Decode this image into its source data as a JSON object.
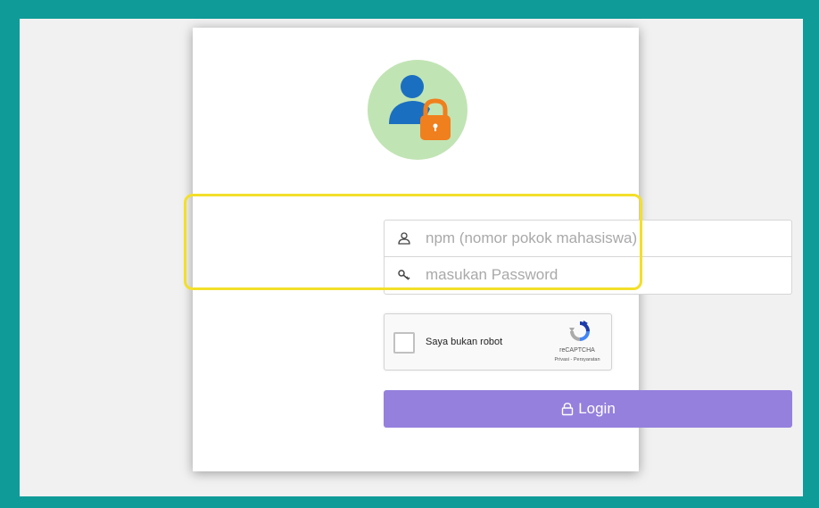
{
  "form": {
    "npm_placeholder": "npm (nomor pokok mahasiswa)",
    "npm_value": "",
    "password_placeholder": "masukan Password",
    "password_value": ""
  },
  "captcha": {
    "label": "Saya bukan robot",
    "brand": "reCAPTCHA",
    "terms": "Privasi - Persyaratan",
    "checked": false
  },
  "login": {
    "label": "Login"
  },
  "icons": {
    "avatar": "user-lock-icon",
    "npm": "user-icon",
    "password": "key-icon",
    "login": "lock-icon",
    "captcha": "recaptcha-logo-icon"
  },
  "colors": {
    "frame": "#0f9b98",
    "highlight": "#f3df2a",
    "login_button": "#9580dd",
    "avatar_bg": "#c1e4b4",
    "user_blue": "#1b6fc0",
    "lock_orange": "#f07f1e"
  }
}
